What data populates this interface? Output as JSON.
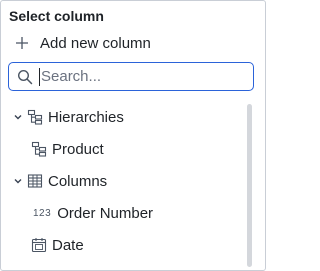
{
  "panel": {
    "title": "Select column",
    "add_label": "Add new column"
  },
  "search": {
    "placeholder": "Search...",
    "value": ""
  },
  "tree": {
    "hierarchies_label": "Hierarchies",
    "product_label": "Product",
    "columns_label": "Columns",
    "order_number_type": "123",
    "order_number_label": "Order Number",
    "date_label": "Date"
  },
  "icons": {
    "add": "plus-icon",
    "search": "search-icon",
    "expand": "chevron-down-icon",
    "hierarchy": "hierarchy-icon",
    "table": "table-icon",
    "number": "number-type-icon",
    "date": "calendar-icon"
  },
  "colors": {
    "accent": "#2b63d9",
    "border": "#c9ced6",
    "text": "#1f2328"
  }
}
